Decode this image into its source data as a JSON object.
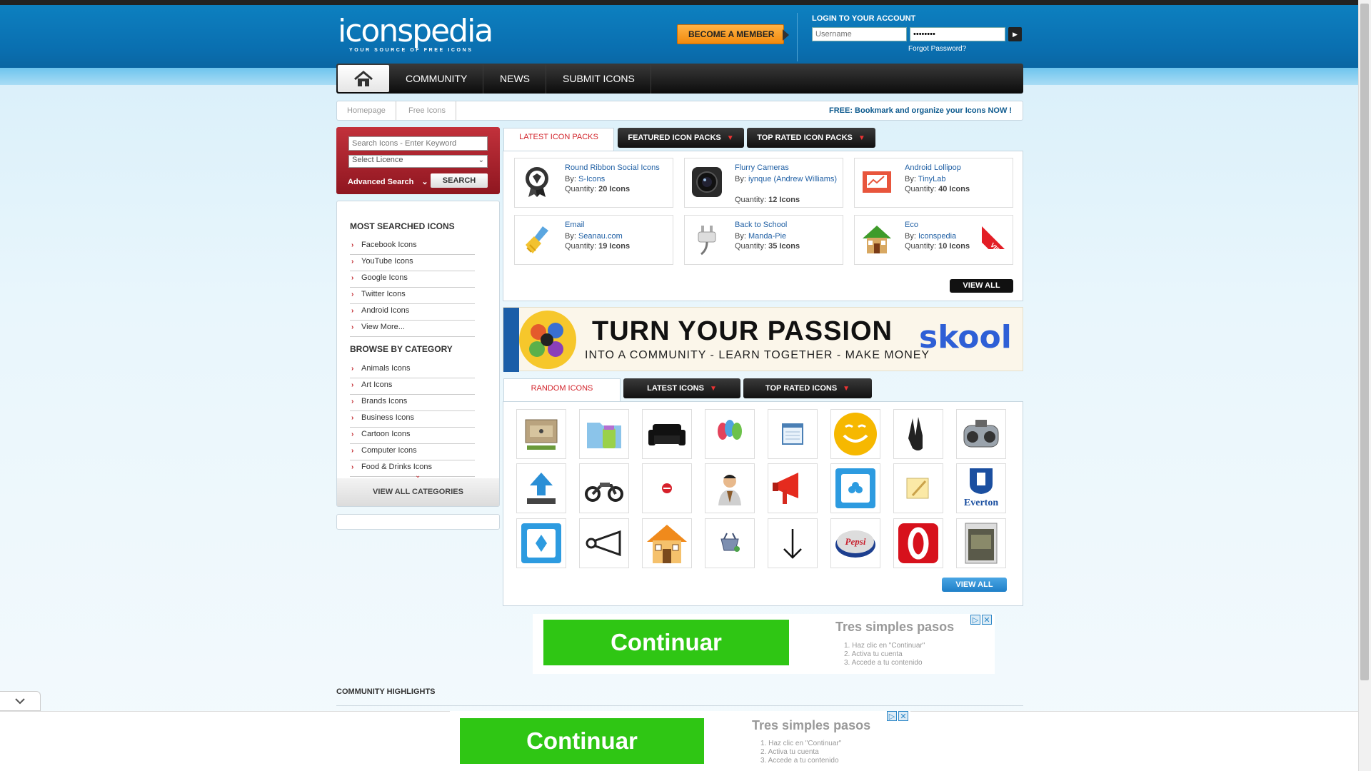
{
  "header": {
    "logo_word": "iconspedia",
    "logo_tagline": "YOUR SOURCE OF FREE ICONS",
    "become_member": "BECOME A MEMBER",
    "login_title": "LOGIN TO YOUR ACCOUNT",
    "username_placeholder": "Username",
    "password_value": "••••••••",
    "forgot": "Forgot Password?"
  },
  "nav": {
    "home_icon": "home-icon",
    "items": [
      "COMMUNITY",
      "NEWS",
      "SUBMIT ICONS"
    ]
  },
  "breadcrumb": {
    "items": [
      "Homepage",
      "Free Icons"
    ],
    "promo": "FREE: Bookmark and organize your Icons NOW !"
  },
  "search": {
    "placeholder": "Search Icons - Enter Keyword",
    "licence": "Select Licence",
    "advanced": "Advanced Search",
    "button": "SEARCH"
  },
  "sidebar": {
    "most_searched_title": "MOST SEARCHED ICONS",
    "most_searched": [
      "Facebook Icons",
      "YouTube Icons",
      "Google Icons",
      "Twitter Icons",
      "Android Icons",
      "View More..."
    ],
    "browse_title": "BROWSE BY CATEGORY",
    "categories": [
      "Animals Icons",
      "Art Icons",
      "Brands Icons",
      "Business Icons",
      "Cartoon Icons",
      "Computer Icons",
      "Food & Drinks Icons"
    ],
    "view_all_categories": "VIEW ALL CATEGORIES"
  },
  "pack_tabs": {
    "latest": "LATEST ICON PACKS",
    "featured": "FEATURED ICON PACKS",
    "top_rated": "TOP RATED ICON PACKS"
  },
  "packs": [
    {
      "title": "Round Ribbon Social Icons",
      "by_label": "By:",
      "author": "S-Icons",
      "qty_label": "Quantity:",
      "qty": "20 Icons",
      "icon": "ribbon-badge-icon"
    },
    {
      "title": "Flurry Cameras",
      "by_label": "By:",
      "author": "iynque (Andrew Williams)",
      "qty_label": "Quantity:",
      "qty": "12 Icons",
      "icon": "camera-icon"
    },
    {
      "title": "Android Lollipop",
      "by_label": "By:",
      "author": "TinyLab",
      "qty_label": "Quantity:",
      "qty": "40 Icons",
      "icon": "chart-icon"
    },
    {
      "title": "Email",
      "by_label": "By:",
      "author": "Seanau.com",
      "qty_label": "Quantity:",
      "qty": "19 Icons",
      "icon": "broom-icon"
    },
    {
      "title": "Back to School",
      "by_label": "By:",
      "author": "Manda-Pie",
      "qty_label": "Quantity:",
      "qty": "35 Icons",
      "icon": "plug-icon"
    },
    {
      "title": "Eco",
      "by_label": "By:",
      "author": "Iconspedia",
      "qty_label": "Quantity:",
      "qty": "10 Icons",
      "icon": "house-icon",
      "badge": "VIP"
    }
  ],
  "packs_view_all": "VIEW ALL",
  "ad_banner": {
    "headline": "TURN YOUR PASSION",
    "sub": "INTO A COMMUNITY - LEARN TOGETHER - MAKE MONEY",
    "brand": "skool"
  },
  "icon_tabs": {
    "random": "RANDOM ICONS",
    "latest": "LATEST ICONS",
    "top_rated": "TOP RATED ICONS"
  },
  "random_icons": [
    "drawer-icon",
    "folder-drink-icon",
    "sofa-icon",
    "light-bulbs-icon",
    "window-icon",
    "smiley-icon",
    "victory-hand-icon",
    "stereo-icon",
    "upload-icon",
    "motorcycle-icon",
    "stop-icon",
    "man-icon",
    "megaphone-icon",
    "club-card-icon",
    "note-icon",
    "everton-badge-icon",
    "diamond-card-icon",
    "horn-icon",
    "home-icon",
    "basket-icon",
    "down-arrow-icon",
    "pepsi-cap-icon",
    "opera-icon",
    "game-cover-icon"
  ],
  "everton_label": "Everton",
  "pepsi_label": "Pepsi",
  "icons_view_all": "VIEW ALL",
  "ads": {
    "button": "Continuar",
    "steps_title": "Tres simples pasos",
    "steps": [
      "1. Haz clic en \"Continuar\"",
      "2. Activa tu cuenta",
      "3. Accede a tu contenido"
    ]
  },
  "community_title": "COMMUNITY HIGHLIGHTS",
  "colors": {
    "accent_red": "#d2232a",
    "link_blue": "#1f5fa4",
    "header_blue": "#0d80c0",
    "ad_green": "#2fc614"
  }
}
